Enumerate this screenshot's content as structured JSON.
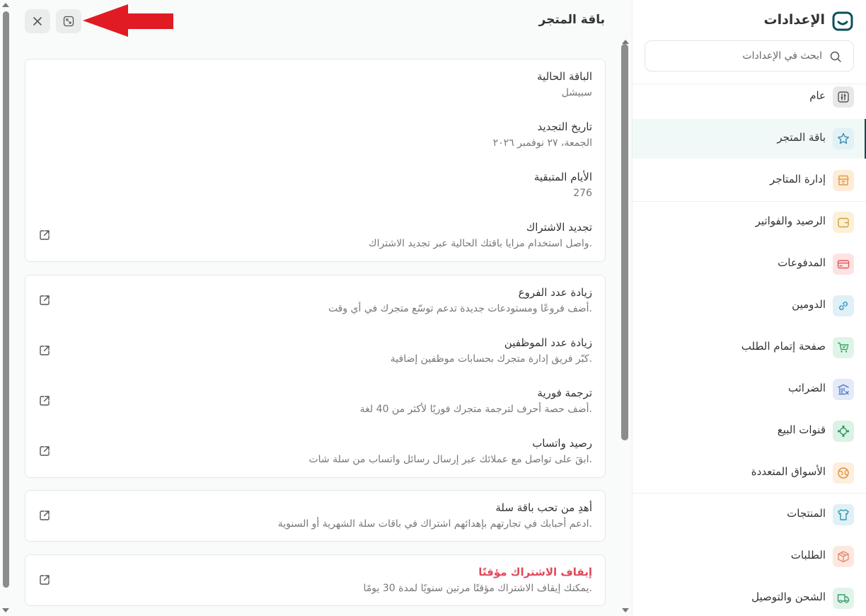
{
  "panel": {
    "title": "باقة المتجر"
  },
  "plan_card": {
    "items": [
      {
        "title": "الباقة الحالية",
        "value": "سبيشل"
      },
      {
        "title": "تاريخ التجديد",
        "value": "الجمعة، ٢٧ نوفمبر ٢٠٢٦"
      },
      {
        "title": "الأيام المتبقية",
        "value": "276"
      },
      {
        "title": "تجديد الاشتراك",
        "value": "واصل استخدام مزايا باقتك الحالية عبر تجديد الاشتراك."
      }
    ]
  },
  "addons_card": {
    "items": [
      {
        "title": "زيادة عدد الفروع",
        "value": "أضف فروعًا ومستودعات جديدة تدعم توسّع متجرك في أي وقت."
      },
      {
        "title": "زيادة عدد الموظفين",
        "value": "كبّر فريق إدارة متجرك بحسابات موظفين إضافية."
      },
      {
        "title": "ترجمة فورية",
        "value": "أضف حصة أحرف لترجمة متجرك فوريًا لأكثر من 40 لغة."
      },
      {
        "title": "رصيد واتساب",
        "value": "ابقَ على تواصل مع عملائك عبر إرسال رسائل واتساب من سلة شات."
      }
    ]
  },
  "gift_card": {
    "title": "أهدِ من تحب باقة سلة",
    "value": "ادعم أحبابك في تجارتهم بإهدائهم اشتراك في باقات سلة الشهرية أو السنوية."
  },
  "pause_card": {
    "title": "إيقاف الاشتراك مؤقتًا",
    "value": "يمكنك إيقاف الاشتراك مؤقتًا مرتين سنويًا لمدة 30 يومًا."
  },
  "sidebar": {
    "title": "الإعدادات",
    "search_placeholder": "ابحث في الإعدادات",
    "items": [
      {
        "label": "عام",
        "icon": "sliders-icon",
        "color": "#e8e8e8",
        "stroke": "#555555"
      },
      {
        "label": "باقة المتجر",
        "icon": "star-icon",
        "color": "#e1f1f6",
        "stroke": "#3a8fb0"
      },
      {
        "label": "إدارة المتاجر",
        "icon": "store-icon",
        "color": "#fdecd8",
        "stroke": "#e29a3f"
      },
      {
        "label": "الرصيد والفواتير",
        "icon": "wallet-icon",
        "color": "#fbf0d9",
        "stroke": "#d4a23a"
      },
      {
        "label": "المدفوعات",
        "icon": "card-icon",
        "color": "#fde3e3",
        "stroke": "#e05a5a"
      },
      {
        "label": "الدومين",
        "icon": "link-icon",
        "color": "#dff0f7",
        "stroke": "#3a9ac4"
      },
      {
        "label": "صفحة إتمام الطلب",
        "icon": "cart-icon",
        "color": "#dff4e8",
        "stroke": "#3aa866"
      },
      {
        "label": "الضرائب",
        "icon": "tax-icon",
        "color": "#e3eaf8",
        "stroke": "#4a6fc4"
      },
      {
        "label": "قنوات البيع",
        "icon": "channels-icon",
        "color": "#dcf2e6",
        "stroke": "#2f9a62"
      },
      {
        "label": "الأسواق المتعددة",
        "icon": "globe-icon",
        "color": "#fdeedd",
        "stroke": "#e08f3a"
      },
      {
        "label": "المنتجات",
        "icon": "shirt-icon",
        "color": "#dff1f5",
        "stroke": "#2f96ae"
      },
      {
        "label": "الطلبات",
        "icon": "box-icon",
        "color": "#fde8e0",
        "stroke": "#e08a6a"
      },
      {
        "label": "الشحن والتوصيل",
        "icon": "truck-icon",
        "color": "#e2f3ea",
        "stroke": "#3a9e6a"
      }
    ]
  }
}
